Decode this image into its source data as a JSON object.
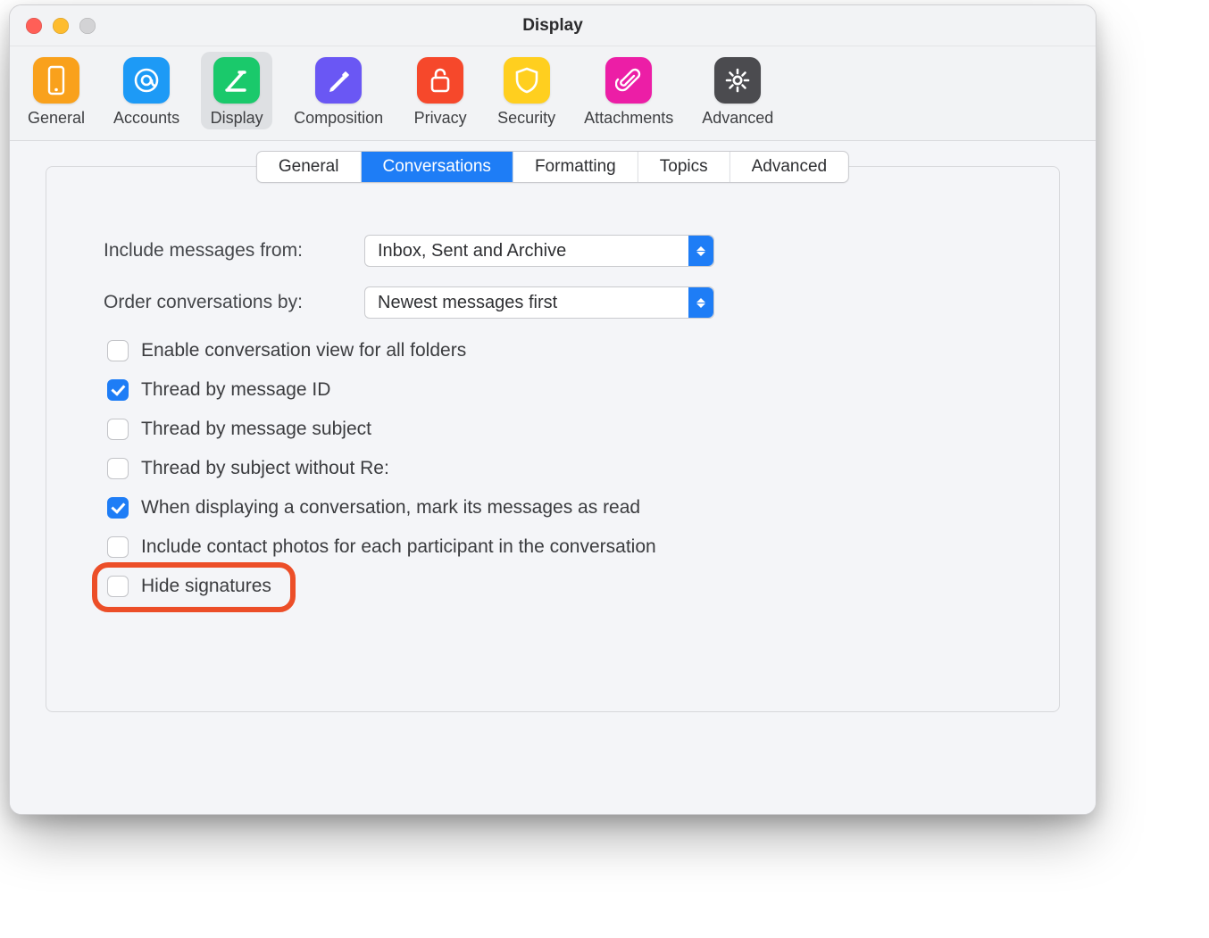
{
  "window": {
    "title": "Display"
  },
  "toolbar": {
    "items": [
      {
        "id": "general",
        "label": "General",
        "color": "#f9a11c"
      },
      {
        "id": "accounts",
        "label": "Accounts",
        "color": "#1d9af6"
      },
      {
        "id": "display",
        "label": "Display",
        "color": "#1ac96b"
      },
      {
        "id": "composition",
        "label": "Composition",
        "color": "#6a57f4"
      },
      {
        "id": "privacy",
        "label": "Privacy",
        "color": "#f6482b"
      },
      {
        "id": "security",
        "label": "Security",
        "color": "#ffcf1f"
      },
      {
        "id": "attachments",
        "label": "Attachments",
        "color": "#ec1ea6"
      },
      {
        "id": "advanced",
        "label": "Advanced",
        "color": "#4b4b4f"
      }
    ],
    "active_id": "display"
  },
  "subtabs": {
    "items": [
      {
        "id": "general",
        "label": "General"
      },
      {
        "id": "conversations",
        "label": "Conversations"
      },
      {
        "id": "formatting",
        "label": "Formatting"
      },
      {
        "id": "topics",
        "label": "Topics"
      },
      {
        "id": "advanced",
        "label": "Advanced"
      }
    ],
    "active_id": "conversations"
  },
  "form": {
    "include_label": "Include messages from:",
    "include_value": "Inbox, Sent and Archive",
    "order_label": "Order conversations by:",
    "order_value": "Newest messages first",
    "checks": [
      {
        "id": "enable_all_folders",
        "label": "Enable conversation view for all folders",
        "checked": false
      },
      {
        "id": "thread_msgid",
        "label": "Thread by message ID",
        "checked": true
      },
      {
        "id": "thread_subject",
        "label": "Thread by message subject",
        "checked": false
      },
      {
        "id": "thread_subject_nore",
        "label": "Thread by subject without Re:",
        "checked": false
      },
      {
        "id": "mark_as_read",
        "label": "When displaying a conversation, mark its messages as read",
        "checked": true
      },
      {
        "id": "contact_photos",
        "label": "Include contact photos for each participant in the conversation",
        "checked": false
      },
      {
        "id": "hide_signatures",
        "label": "Hide signatures",
        "checked": false
      }
    ],
    "highlight_check_id": "hide_signatures"
  }
}
